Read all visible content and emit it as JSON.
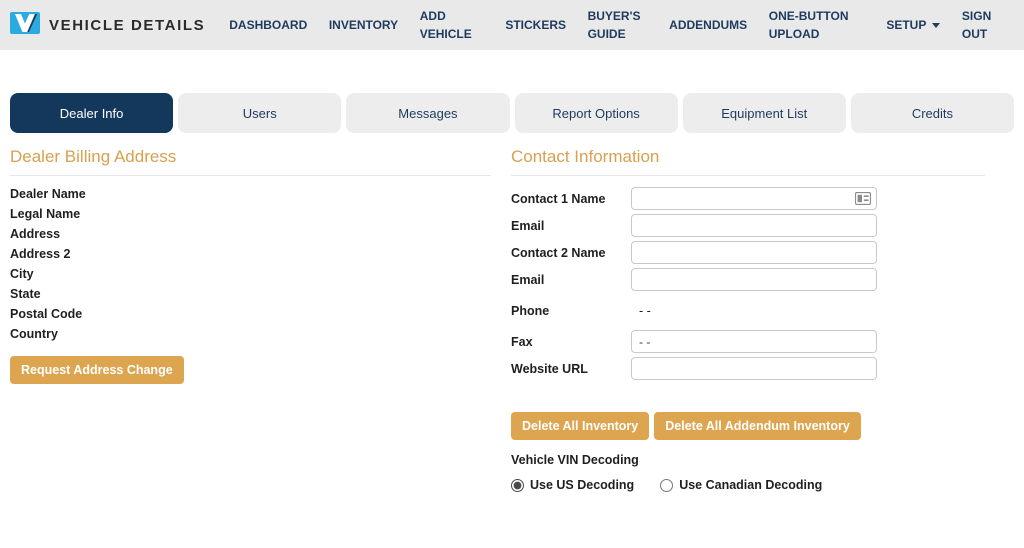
{
  "brand": {
    "title": "VEHICLE DETAILS"
  },
  "nav": {
    "items": [
      {
        "label": "DASHBOARD"
      },
      {
        "label": "INVENTORY"
      },
      {
        "label": "ADD VEHICLE"
      },
      {
        "label": "STICKERS"
      },
      {
        "label": "BUYER'S GUIDE"
      },
      {
        "label": "ADDENDUMS"
      },
      {
        "label": "ONE-BUTTON UPLOAD"
      },
      {
        "label": "SETUP"
      },
      {
        "label": "SIGN OUT"
      }
    ]
  },
  "tabs": [
    {
      "label": "Dealer Info",
      "active": true
    },
    {
      "label": "Users",
      "active": false
    },
    {
      "label": "Messages",
      "active": false
    },
    {
      "label": "Report Options",
      "active": false
    },
    {
      "label": "Equipment List",
      "active": false
    },
    {
      "label": "Credits",
      "active": false
    }
  ],
  "billing": {
    "heading": "Dealer Billing Address",
    "labels": [
      "Dealer Name",
      "Legal Name",
      "Address",
      "Address 2",
      "City",
      "State",
      "Postal Code",
      "Country"
    ],
    "request_button_label": "Request Address Change"
  },
  "contact": {
    "heading": "Contact Information",
    "rows": [
      {
        "label": "Contact 1 Name",
        "value": ""
      },
      {
        "label": "Email",
        "value": ""
      },
      {
        "label": "Contact 2 Name",
        "value": ""
      },
      {
        "label": "Email",
        "value": ""
      },
      {
        "label": "Phone",
        "value": "- -"
      },
      {
        "label": "Fax",
        "value": "- -"
      },
      {
        "label": "Website URL",
        "value": ""
      }
    ],
    "delete_inventory_label": "Delete All Inventory",
    "delete_addendum_label": "Delete All Addendum Inventory",
    "vin_heading": "Vehicle VIN Decoding",
    "vin_options": [
      {
        "label": "Use US Decoding",
        "selected": true
      },
      {
        "label": "Use Canadian Decoding",
        "selected": false
      }
    ]
  },
  "colors": {
    "accent_orange": "#DDA54F",
    "heading_orange": "#D9A04F",
    "active_tab_navy": "#14385C",
    "nav_text_navy": "#1E3A5F",
    "navbar_bg": "#E9E9E9",
    "tab_bg": "#EDEDED",
    "logo_blue": "#29ABE2"
  }
}
